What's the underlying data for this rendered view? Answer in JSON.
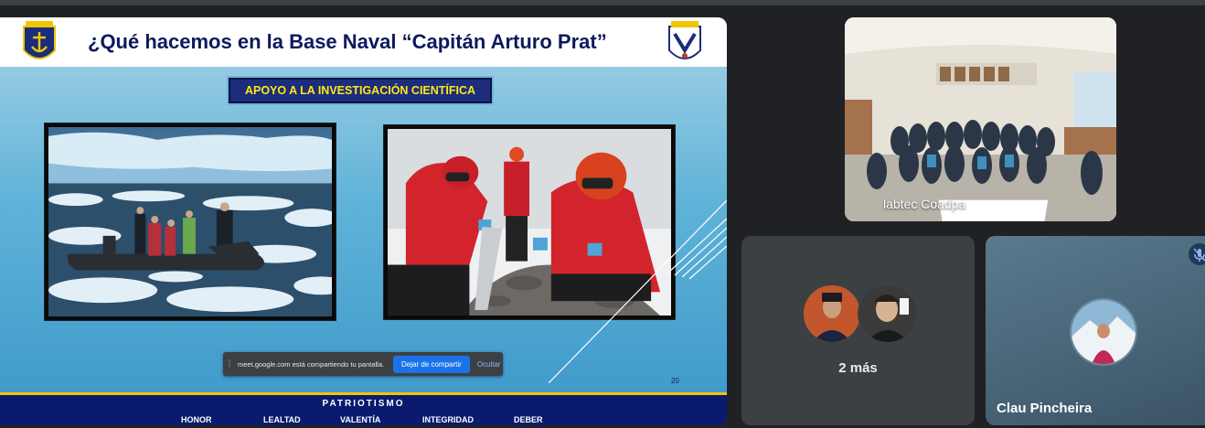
{
  "slide": {
    "title": "¿Qué hacemos en la Base Naval “Capitán Arturo Prat”",
    "subtitle": "APOYO A LA INVESTIGACIÓN CIENTÍFICA",
    "page_number": "20",
    "footer_title": "PATRIOTISMO",
    "values": [
      "HONOR",
      "LEALTAD",
      "VALENTÍA",
      "INTEGRIDAD",
      "DEBER"
    ]
  },
  "share_bar": {
    "message": "meet.google.com está compartiendo tu pantalla.",
    "stop_label": "Dejar de compartir",
    "hide_label": "Ocultar"
  },
  "participants": {
    "classroom_name": "labtec Coadpa",
    "more_label": "2 más",
    "clau_name": "Clau Pincheira"
  },
  "colors": {
    "meet_bg": "#202124",
    "tile_bg": "#3c4043",
    "accent_blue": "#1a73e8",
    "slide_navy": "#0a1a6e",
    "banner_yellow": "#ffe81a"
  },
  "icons": [
    "navy-crest-icon",
    "pin-icon",
    "mic-off-icon",
    "drag-handle-icon"
  ]
}
